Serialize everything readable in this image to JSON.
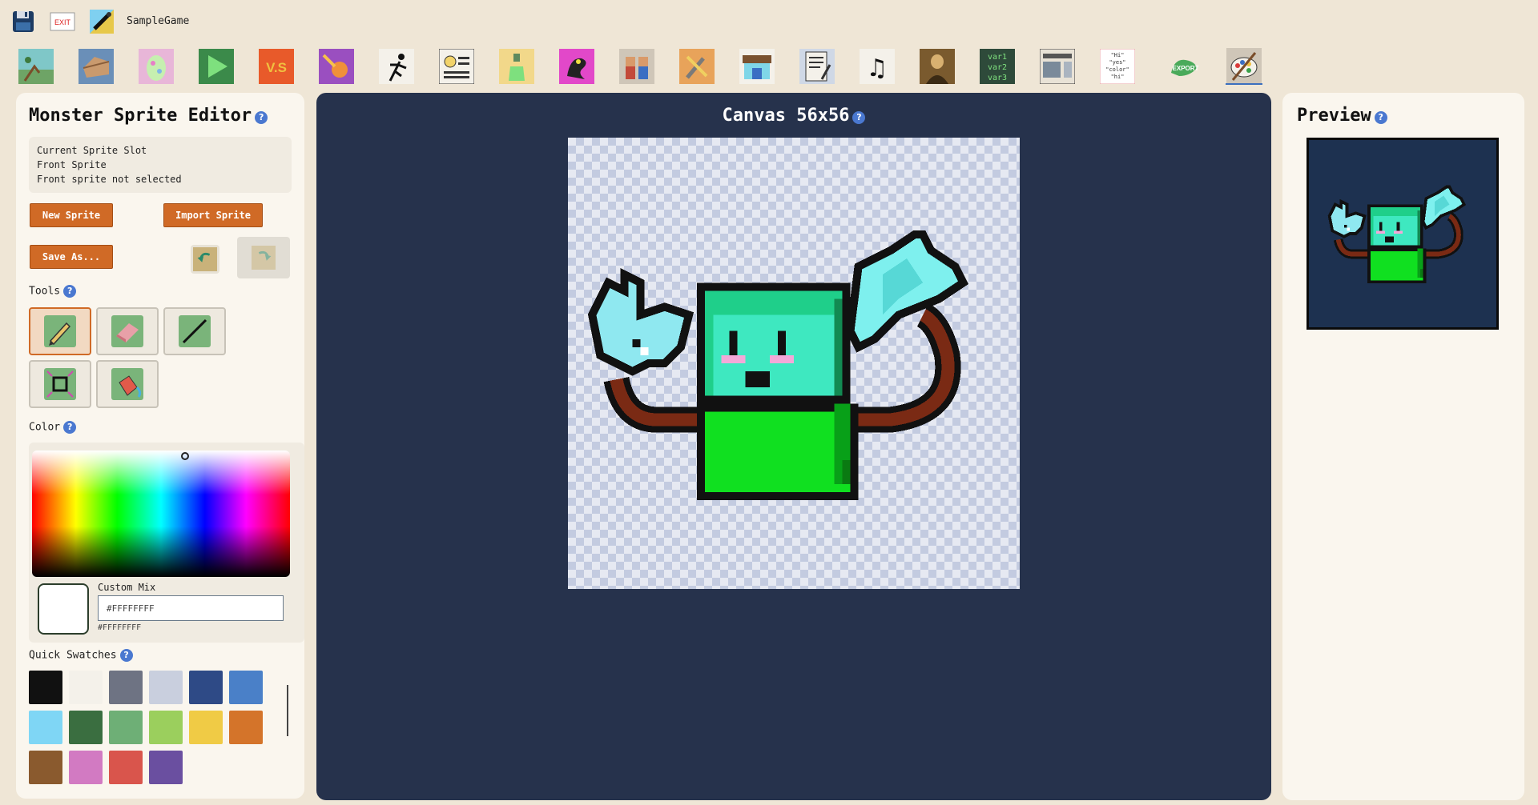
{
  "topbar": {
    "exit_label": "EXIT",
    "game_title": "SampleGame"
  },
  "toolstrip": {
    "tabs": [
      "map-tab",
      "items-tab",
      "egg-tab",
      "play-tab",
      "battle-tab",
      "fire-move-tab",
      "running-tab",
      "trainer-card-tab",
      "potion-tab",
      "monster-tab",
      "npc-tab",
      "tools-tab",
      "shop-tab",
      "script-tab",
      "music-tab",
      "art-tab",
      "variables-tab",
      "layout-tab",
      "dialogue-tab",
      "export-tab",
      "sprite-editor-tab"
    ],
    "variables_text": [
      "var1",
      "var2",
      "var3"
    ],
    "dialogue_text": [
      "\"Hi\"",
      "\"yes\"",
      "\"color\"",
      "\"hi\""
    ],
    "export_text": "EXPORT",
    "battle_text": "V.S",
    "active_tab": "sprite-editor-tab"
  },
  "left": {
    "title": "Monster Sprite Editor",
    "slot_lines": [
      "Current Sprite Slot",
      "Front Sprite",
      "Front sprite not selected"
    ],
    "new_sprite": "New Sprite",
    "import_sprite": "Import Sprite",
    "save_as": "Save As...",
    "tools_label": "Tools",
    "tools": [
      "pencil",
      "eraser",
      "line",
      "select",
      "fill"
    ],
    "selected_tool": "pencil",
    "color_label": "Color",
    "custom_mix_label": "Custom Mix",
    "hex_value": "#FFFFFFFF",
    "hex_display": "#FFFFFFFF",
    "quick_swatches_label": "Quick Swatches",
    "swatches": [
      "#111111",
      "#f4f1ea",
      "#6e7383",
      "#c9cfde",
      "#2e4a86",
      "#4a80c8",
      "#7fd6f5",
      "#3a6e40",
      "#6eaf76",
      "#9bcf5d",
      "#f0cb45",
      "#d4742a",
      "#8a5a2e",
      "#d27ac2",
      "#d9554c",
      "#6a4fa0"
    ]
  },
  "center": {
    "title": "Canvas 56x56"
  },
  "right": {
    "title": "Preview"
  },
  "help_glyph": "?"
}
